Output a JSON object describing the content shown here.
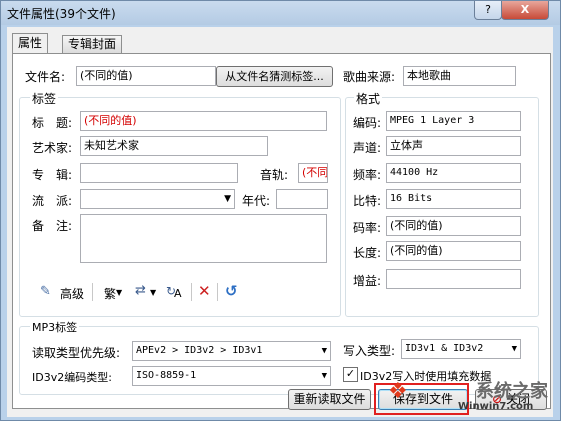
{
  "window": {
    "title": "文件属性(39个文件)",
    "help_glyph": "?",
    "close_glyph": "X"
  },
  "tabs": [
    {
      "label": "属性"
    },
    {
      "label": "专辑封面"
    }
  ],
  "file": {
    "name_label": "文件名:",
    "name_value": "(不同的值)",
    "guess_button": "从文件名猜测标签...",
    "source_label": "歌曲来源:",
    "source_value": "本地歌曲"
  },
  "tags": {
    "group_title": "标签",
    "title_label": "标　题:",
    "title_value": "(不同的值)",
    "artist_label": "艺术家:",
    "artist_value": "未知艺术家",
    "album_label": "专　辑:",
    "album_value": "",
    "track_label": "音轨:",
    "track_value": "(不同",
    "genre_label": "流　派:",
    "genre_value": "",
    "year_label": "年代:",
    "year_value": "",
    "comment_label": "备　注:",
    "comment_value": ""
  },
  "toolbar": {
    "advanced_label": "高级",
    "trad_label": "繁",
    "aa_label": "A"
  },
  "format": {
    "group_title": "格式",
    "codec_label": "编码:",
    "codec_value": "MPEG 1 Layer 3",
    "channel_label": "声道:",
    "channel_value": "立体声",
    "freq_label": "频率:",
    "freq_value": "44100 Hz",
    "bits_label": "比特:",
    "bits_value": "16 Bits",
    "bitrate_label": "码率:",
    "bitrate_value": "(不同的值)",
    "length_label": "长度:",
    "length_value": "(不同的值)",
    "gain_label": "增益:",
    "gain_value": ""
  },
  "mp3": {
    "group_title": "MP3标签",
    "read_priority_label": "读取类型优先级:",
    "read_priority_value": "APEv2 > ID3v2 > ID3v1",
    "write_type_label": "写入类型:",
    "write_type_value": "ID3v1 & ID3v2",
    "encoding_label": "ID3v2编码类型:",
    "encoding_value": "ISO-8859-1",
    "padding_checked": true,
    "padding_label": "ID3v2写入时使用填充数据"
  },
  "buttons": {
    "reread": "重新读取文件",
    "save": "保存到文件",
    "close": "关闭"
  },
  "watermark": {
    "text": "系统之家",
    "url": "Winwin7.com"
  },
  "colors": {
    "accent_red": "#d40000",
    "highlight_box": "#e02020"
  }
}
